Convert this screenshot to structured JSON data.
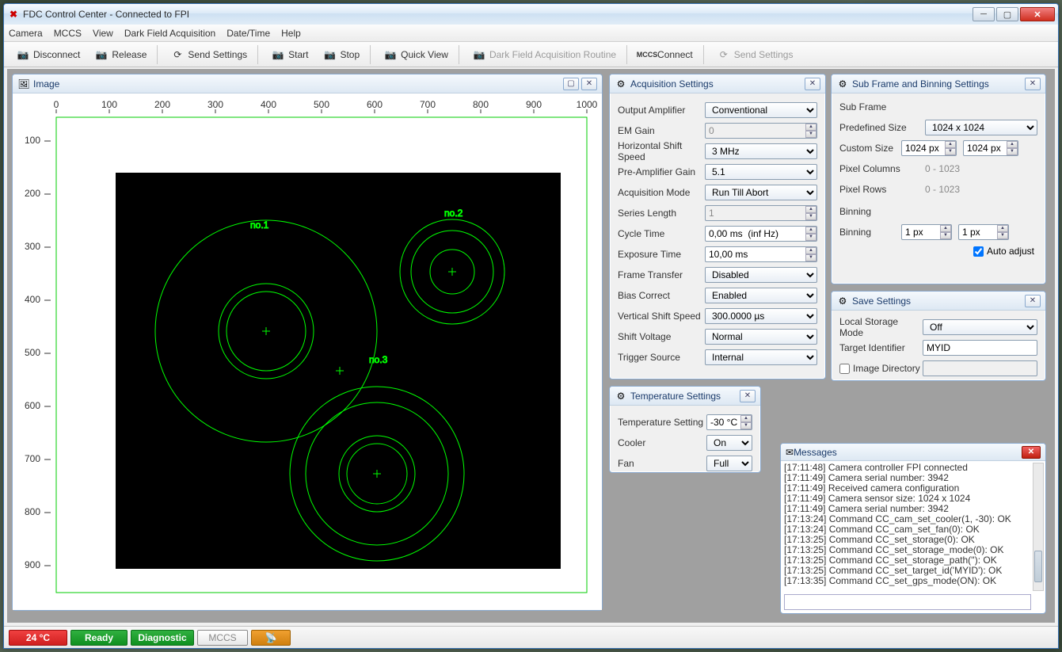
{
  "titlebar": {
    "text": "FDC Control Center  - Connected to FPI"
  },
  "menu": {
    "camera": "Camera",
    "mccs": "MCCS",
    "view": "View",
    "dfa": "Dark Field Acquisition",
    "datetime": "Date/Time",
    "help": "Help"
  },
  "toolbar": {
    "disconnect": "Disconnect",
    "release": "Release",
    "sendsettings": "Send Settings",
    "start": "Start",
    "stop": "Stop",
    "quickview": "Quick View",
    "dfa_routine": "Dark Field Acquisition Routine",
    "connect": "Connect",
    "sendsettings2": "Send Settings"
  },
  "image_panel": {
    "title": "Image",
    "x_ticks": [
      "0",
      "100",
      "200",
      "300",
      "400",
      "500",
      "600",
      "700",
      "800",
      "900",
      "1000"
    ],
    "y_ticks": [
      "100",
      "200",
      "300",
      "400",
      "500",
      "600",
      "700",
      "800",
      "900"
    ],
    "labels": {
      "no1": "no.1",
      "no2": "no.2",
      "no3": "no.3"
    }
  },
  "acq": {
    "title": "Acquisition Settings",
    "output_amplifier": {
      "label": "Output Amplifier",
      "value": "Conventional"
    },
    "em_gain": {
      "label": "EM Gain",
      "value": "0"
    },
    "hss": {
      "label": "Horizontal Shift Speed",
      "value": "3 MHz"
    },
    "pre_amp": {
      "label": "Pre-Amplifier Gain",
      "value": "5.1"
    },
    "mode": {
      "label": "Acquisition Mode",
      "value": "Run Till Abort"
    },
    "series": {
      "label": "Series Length",
      "value": "1"
    },
    "cycle": {
      "label": "Cycle Time",
      "value": "0,00 ms  (inf Hz)"
    },
    "exposure": {
      "label": "Exposure Time",
      "value": "10,00 ms"
    },
    "frame": {
      "label": "Frame Transfer",
      "value": "Disabled"
    },
    "bias": {
      "label": "Bias Correct",
      "value": "Enabled"
    },
    "vss": {
      "label": "Vertical Shift Speed",
      "value": "300.0000 µs"
    },
    "shift_v": {
      "label": "Shift Voltage",
      "value": "Normal"
    },
    "trigger": {
      "label": "Trigger Source",
      "value": "Internal"
    }
  },
  "subframe": {
    "title": "Sub Frame and Binning Settings",
    "subhead": "Sub Frame",
    "predef": {
      "label": "Predefined Size",
      "value": "1024 x 1024"
    },
    "custom": {
      "label": "Custom Size",
      "w": "1024 px",
      "h": "1024 px"
    },
    "pixcols": {
      "label": "Pixel Columns",
      "value": "0 - 1023"
    },
    "pixrows": {
      "label": "Pixel Rows",
      "value": "0 - 1023"
    },
    "bin_head": "Binning",
    "binning": {
      "label": "Binning",
      "x": "1 px",
      "y": "1 px"
    },
    "auto": {
      "label": "Auto adjust"
    }
  },
  "save": {
    "title": "Save Settings",
    "storage": {
      "label": "Local Storage Mode",
      "value": "Off"
    },
    "target": {
      "label": "Target Identifier",
      "value": "MYID"
    },
    "imgdir": {
      "label": "Image Directory"
    }
  },
  "temp": {
    "title": "Temperature Settings",
    "setting": {
      "label": "Temperature Setting",
      "value": "-30 °C"
    },
    "cooler": {
      "label": "Cooler",
      "value": "On"
    },
    "fan": {
      "label": "Fan",
      "value": "Full"
    }
  },
  "messages": {
    "title": "Messages",
    "lines": [
      "[17:11:48] Camera controller FPI connected",
      "[17:11:49] Camera serial number: 3942",
      "[17:11:49] Received camera configuration",
      "[17:11:49] Camera sensor size: 1024 x 1024",
      "[17:11:49] Camera serial number: 3942",
      "[17:13:24] Command CC_cam_set_cooler(1, -30): OK",
      "[17:13:24] Command CC_cam_set_fan(0): OK",
      "[17:13:25] Command CC_set_storage(0): OK",
      "[17:13:25] Command CC_set_storage_mode(0): OK",
      "[17:13:25] Command CC_set_storage_path(''): OK",
      "[17:13:25] Command CC_set_target_id('MYID'): OK",
      "[17:13:35] Command CC_set_gps_mode(ON): OK"
    ]
  },
  "status": {
    "temp": "24 °C",
    "ready": "Ready",
    "diag": "Diagnostic",
    "mccs": "MCCS"
  }
}
